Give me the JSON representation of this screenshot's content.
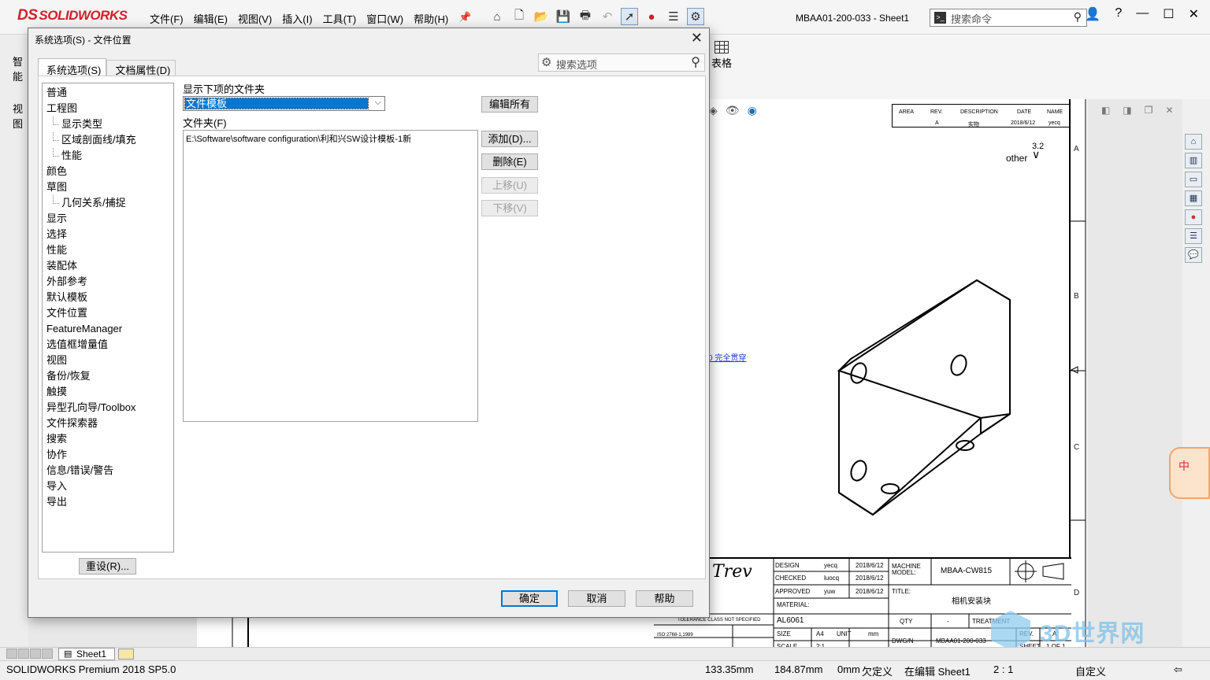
{
  "app": {
    "logo_text": "SOLIDWORKS",
    "logo_mark": "DS",
    "menu": [
      "文件(F)",
      "编辑(E)",
      "视图(V)",
      "插入(I)",
      "工具(T)",
      "窗口(W)",
      "帮助(H)"
    ],
    "document_title": "MBAA01-200-033 - Sheet1",
    "search_commands_placeholder": "搜索命令",
    "left_strip_label": "视图",
    "left_strip_label2": "智能",
    "table_label": "表格"
  },
  "dialog": {
    "title": "系统选项(S) - 文件位置",
    "tabs": [
      "系统选项(S)",
      "文档属性(D)"
    ],
    "search_placeholder": "搜索选项",
    "tree": [
      {
        "label": "普通",
        "child": false
      },
      {
        "label": "工程图",
        "child": false
      },
      {
        "label": "显示类型",
        "child": true
      },
      {
        "label": "区域剖面线/填充",
        "child": true
      },
      {
        "label": "性能",
        "child": true
      },
      {
        "label": "颜色",
        "child": false
      },
      {
        "label": "草图",
        "child": false
      },
      {
        "label": "几何关系/捕捉",
        "child": true
      },
      {
        "label": "显示",
        "child": false
      },
      {
        "label": "选择",
        "child": false
      },
      {
        "label": "性能",
        "child": false
      },
      {
        "label": "装配体",
        "child": false
      },
      {
        "label": "外部参考",
        "child": false
      },
      {
        "label": "默认模板",
        "child": false
      },
      {
        "label": "文件位置",
        "child": false
      },
      {
        "label": "FeatureManager",
        "child": false
      },
      {
        "label": "选值框增量值",
        "child": false
      },
      {
        "label": "视图",
        "child": false
      },
      {
        "label": "备份/恢复",
        "child": false
      },
      {
        "label": "触摸",
        "child": false
      },
      {
        "label": "异型孔向导/Toolbox",
        "child": false
      },
      {
        "label": "文件探索器",
        "child": false
      },
      {
        "label": "搜索",
        "child": false
      },
      {
        "label": "协作",
        "child": false
      },
      {
        "label": "信息/错误/警告",
        "child": false
      },
      {
        "label": "导入",
        "child": false
      },
      {
        "label": "导出",
        "child": false
      }
    ],
    "reset_label": "重设(R)...",
    "show_folders_label": "显示下项的文件夹",
    "show_folders_value": "文件模板",
    "folders_label": "文件夹(F)",
    "folders": [
      "E:\\Software\\software configuration\\利和兴SW设计模板-1新"
    ],
    "edit_all_label": "编辑所有",
    "add_label": "添加(D)...",
    "delete_label": "删除(E)",
    "move_up_label": "上移(U)",
    "move_down_label": "下移(V)",
    "ok_label": "确定",
    "cancel_label": "取消",
    "help_label": "帮助"
  },
  "drawing": {
    "zones": [
      "A",
      "B",
      "C",
      "D"
    ],
    "roughness_label": "other",
    "roughness_value": "3.2",
    "link_text": "0 完全贯穿",
    "rev_table": {
      "headers": [
        "AREA",
        "REV.",
        "DESCRIPTION",
        "DATE",
        "NAME"
      ],
      "values": [
        "",
        "A",
        "实物",
        "2018/6/12",
        "yecq"
      ]
    },
    "title_block": {
      "design": "DESIGN",
      "design_by": "yecq",
      "design_date": "2018/6/12",
      "checked": "CHECKED",
      "checked_by": "luocq",
      "checked_date": "2018/6/12",
      "approved": "APPROVED",
      "approved_by": "yuw",
      "approved_date": "2018/6/12",
      "machine_model_label": "MACHINE MODEL:",
      "machine_model": "MBAA-CW815",
      "title_label": "TITLE:",
      "title": "相机安装块",
      "material_label": "MATERIAL:",
      "material": "AL6061",
      "qty_label": "QTY",
      "qty": "-",
      "treatment_label": "TREATMENT",
      "size_label": "SIZE",
      "size": "A4",
      "unit_label": "UNIT",
      "unit": "mm",
      "dwg_label": "DWG/N",
      "dwg_no": "MBAA01-200-033",
      "rev_label": "REV.",
      "rev": "A",
      "scale_label": "SCALE",
      "scale": "2:1",
      "sheet_label": "SHEET",
      "sheet": "1 OF 1",
      "tolerance_note": "TOLERANCE CLASS NOT SPECIFIED",
      "iso_note": "ISO 2768-1,1989",
      "logo": "Trev"
    }
  },
  "tabs_bar": {
    "sheet_tab": "Sheet1"
  },
  "status": {
    "product": "SOLIDWORKS Premium 2018 SP5.0",
    "x": "133.35mm",
    "y": "184.87mm",
    "z": "0mm",
    "define_state": "欠定义",
    "edit_state": "在编辑 Sheet1",
    "scale": "2 : 1",
    "custom": "自定义"
  },
  "watermark": "3D世界网",
  "ime_label": "中"
}
